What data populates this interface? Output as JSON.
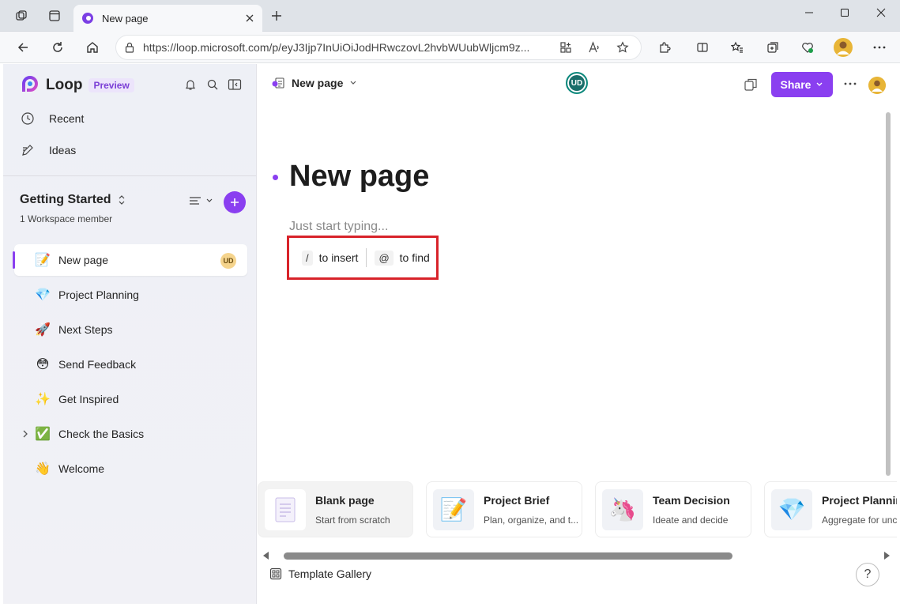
{
  "browser": {
    "tab_title": "New page",
    "url": "https://loop.microsoft.com/p/eyJ3Ijp7InUiOiJodHRwczovL2hvbWUubWljcm9z..."
  },
  "sidebar": {
    "app_name": "Loop",
    "preview_badge": "Preview",
    "nav": [
      {
        "label": "Recent",
        "icon": "clock-icon"
      },
      {
        "label": "Ideas",
        "icon": "pencil-icon"
      }
    ],
    "workspace": {
      "title": "Getting Started",
      "members": "1 Workspace member"
    },
    "pages": [
      {
        "label": "New page",
        "emoji": "📝",
        "avatar": "UD"
      },
      {
        "label": "Project Planning",
        "emoji": "💎"
      },
      {
        "label": "Next Steps",
        "emoji": "🚀"
      },
      {
        "label": "Send Feedback",
        "emoji": "😳"
      },
      {
        "label": "Get Inspired",
        "emoji": "✨"
      },
      {
        "label": "Check the Basics",
        "emoji": "✅"
      },
      {
        "label": "Welcome",
        "emoji": "👋"
      }
    ]
  },
  "header": {
    "breadcrumb": "New page",
    "presence": "UD",
    "share_label": "Share"
  },
  "page": {
    "title": "New page",
    "placeholder": "Just start typing...",
    "hint_insert_key": "/",
    "hint_insert": "to insert",
    "hint_find_key": "@",
    "hint_find": "to find"
  },
  "templates": [
    {
      "name": "Blank page",
      "desc": "Start from scratch",
      "emoji": "📄"
    },
    {
      "name": "Project Brief",
      "desc": "Plan, organize, and t...",
      "emoji": "📝"
    },
    {
      "name": "Team Decision",
      "desc": "Ideate and decide",
      "emoji": "🦄"
    },
    {
      "name": "Project Plannin",
      "desc": "Aggregate for unc",
      "emoji": "💎"
    }
  ],
  "footer": {
    "gallery_label": "Template Gallery",
    "help": "?"
  },
  "colors": {
    "accent": "#8a3ff0",
    "highlight": "#d8232a"
  }
}
